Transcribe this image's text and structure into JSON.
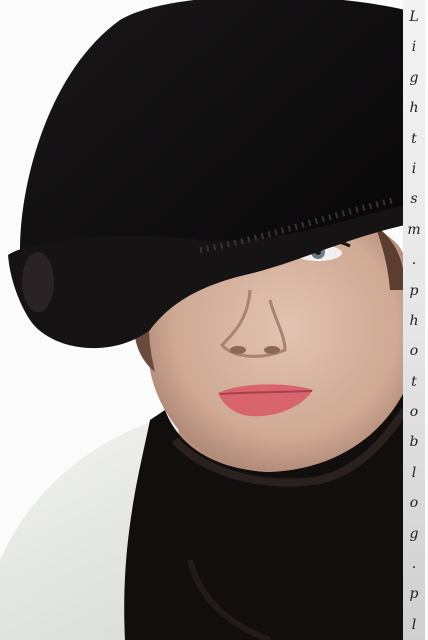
{
  "image": {
    "subject": "portrait",
    "colors": {
      "hat": "#0b0a0b",
      "scarf": "#120e0d",
      "skin": "#d7b6a3",
      "lips": "#d8646e",
      "jacket": "#e9ebe8",
      "background": "#fbfbfb"
    }
  },
  "watermark": {
    "text": "Lightism.photoblog.pl"
  }
}
